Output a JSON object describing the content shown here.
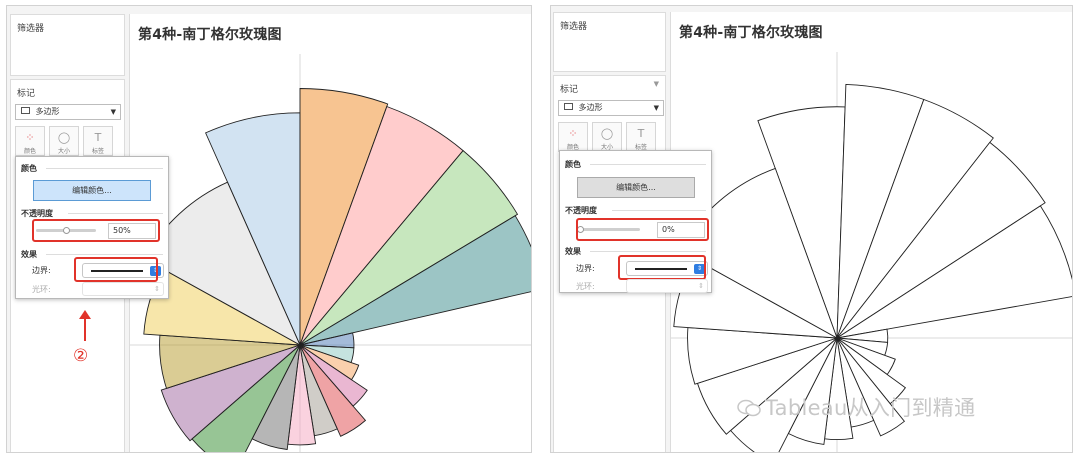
{
  "panels": {
    "left": {
      "filters_title": "筛选器",
      "marks_title": "标记",
      "mark_type": "多边形",
      "mark_buttons": {
        "color": "颜色",
        "size": "大小",
        "label": "标签"
      },
      "sheet_title": "第4种-南丁格尔玫瑰图",
      "popup": {
        "color_section": "颜色",
        "edit_colors_label": "编辑颜色...",
        "opacity_section": "不透明度",
        "opacity_value": "50%",
        "opacity_level": 0.5,
        "effects_section": "效果",
        "border_label": "边界:",
        "halo_label": "光环:"
      },
      "step_label": "②"
    },
    "right": {
      "filters_title": "筛选器",
      "marks_title": "标记",
      "mark_type": "多边形",
      "mark_buttons": {
        "color": "颜色",
        "size": "大小",
        "label": "标签"
      },
      "sheet_title": "第4种-南丁格尔玫瑰图",
      "popup": {
        "color_section": "颜色",
        "edit_colors_label": "编辑颜色...",
        "opacity_section": "不透明度",
        "opacity_value": "0%",
        "opacity_level": 0.0,
        "effects_section": "效果",
        "border_label": "边界:",
        "halo_label": "光环:"
      }
    }
  },
  "watermark": "Tableau从入门到精通",
  "colors": {
    "highlight_box": "#e1332a",
    "edit_button_active": "#cde4fb",
    "edit_button_inactive": "#dedede",
    "spinner": "#2f7de1"
  },
  "rose": {
    "left": {
      "fill_opacity": 0.5,
      "segments": [
        {
          "start": -24,
          "end": 0,
          "value": 0.86,
          "color": "#a5c8e6"
        },
        {
          "start": 0,
          "end": 20,
          "value": 0.95,
          "color": "#f08a24"
        },
        {
          "start": 20,
          "end": 40,
          "value": 0.94,
          "color": "#ff9a9a"
        },
        {
          "start": 40,
          "end": 59,
          "value": 0.94,
          "color": "#8fd07e"
        },
        {
          "start": 59,
          "end": 77,
          "value": 0.93,
          "color": "#3a8b8b"
        },
        {
          "start": 77,
          "end": 93,
          "value": 0.2,
          "color": "#4a77b4"
        },
        {
          "start": 93,
          "end": 109,
          "value": 0.2,
          "color": "#8bc8c0"
        },
        {
          "start": 109,
          "end": 124,
          "value": 0.23,
          "color": "#f5a25b"
        },
        {
          "start": 124,
          "end": 139,
          "value": 0.3,
          "color": "#d66fa5"
        },
        {
          "start": 139,
          "end": 156,
          "value": 0.37,
          "color": "#e0484b"
        },
        {
          "start": 156,
          "end": 171,
          "value": 0.34,
          "color": "#a19b91"
        },
        {
          "start": 171,
          "end": 187,
          "value": 0.37,
          "color": "#f5a5c0"
        },
        {
          "start": 187,
          "end": 207,
          "value": 0.39,
          "color": "#6d6d6d"
        },
        {
          "start": 207,
          "end": 229,
          "value": 0.53,
          "color": "#2f8c2c"
        },
        {
          "start": 229,
          "end": 252,
          "value": 0.54,
          "color": "#a066a0"
        },
        {
          "start": 252,
          "end": 274,
          "value": 0.52,
          "color": "#b59a2a"
        },
        {
          "start": 274,
          "end": 299,
          "value": 0.58,
          "color": "#f0cd55"
        },
        {
          "start": 299,
          "end": 336,
          "value": 0.66,
          "color": "#d9d9d9"
        }
      ]
    },
    "right": {
      "fill_opacity": 0.0,
      "segments": [
        {
          "start": -20,
          "end": 2,
          "value": 0.82
        },
        {
          "start": 2,
          "end": 20,
          "value": 0.9
        },
        {
          "start": 20,
          "end": 38,
          "value": 0.9
        },
        {
          "start": 38,
          "end": 57,
          "value": 0.88
        },
        {
          "start": 57,
          "end": 80,
          "value": 0.86
        },
        {
          "start": 80,
          "end": 95,
          "value": 0.18
        },
        {
          "start": 95,
          "end": 110,
          "value": 0.18
        },
        {
          "start": 110,
          "end": 126,
          "value": 0.22
        },
        {
          "start": 126,
          "end": 141,
          "value": 0.3
        },
        {
          "start": 141,
          "end": 156,
          "value": 0.38
        },
        {
          "start": 156,
          "end": 171,
          "value": 0.32
        },
        {
          "start": 171,
          "end": 187,
          "value": 0.36
        },
        {
          "start": 187,
          "end": 207,
          "value": 0.38
        },
        {
          "start": 207,
          "end": 229,
          "value": 0.5
        },
        {
          "start": 229,
          "end": 252,
          "value": 0.52
        },
        {
          "start": 252,
          "end": 274,
          "value": 0.53
        },
        {
          "start": 274,
          "end": 299,
          "value": 0.58
        },
        {
          "start": 299,
          "end": 340,
          "value": 0.64
        }
      ]
    }
  }
}
